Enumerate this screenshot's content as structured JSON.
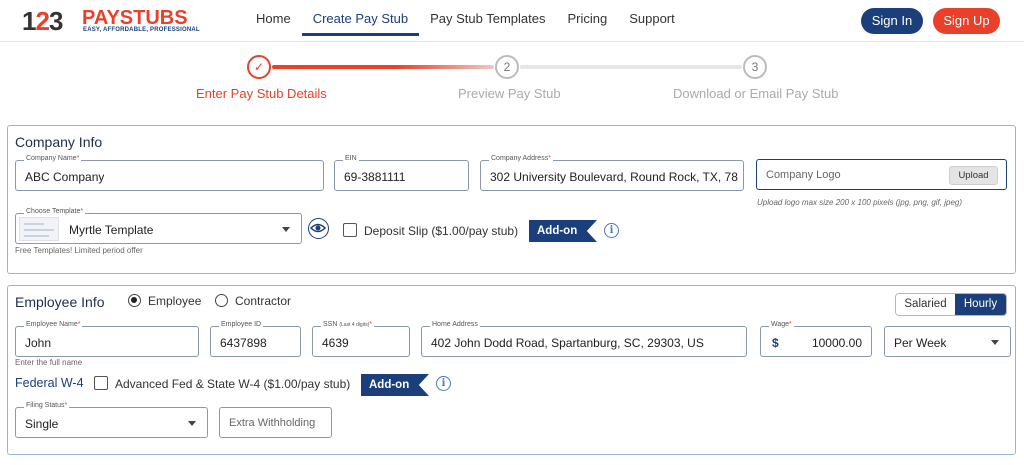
{
  "header": {
    "logo": {
      "number": "123",
      "brand": "PAYSTUBS",
      "tagline": "EASY, AFFORDABLE, PROFESSIONAL"
    },
    "nav": [
      "Home",
      "Create Pay Stub",
      "Pay Stub Templates",
      "Pricing",
      "Support"
    ],
    "active_nav": "Create Pay Stub",
    "sign_in": "Sign In",
    "sign_up": "Sign Up"
  },
  "stepper": {
    "steps": [
      {
        "number": "✓",
        "label": "Enter Pay Stub Details",
        "state": "active"
      },
      {
        "number": "2",
        "label": "Preview Pay Stub",
        "state": "inactive"
      },
      {
        "number": "3",
        "label": "Download or Email Pay Stub",
        "state": "inactive"
      }
    ]
  },
  "company": {
    "title": "Company Info",
    "name_label": "Company Name",
    "name_value": "ABC Company",
    "ein_label": "EIN",
    "ein_value": "69-3881111",
    "address_label": "Company Address",
    "address_value": "302 University Boulevard, Round Rock, TX, 78",
    "logo_placeholder": "Company Logo",
    "upload_label": "Upload",
    "logo_hint": "Upload logo max size 200 x 100 pixels (jpg, png, gif, jpeg)",
    "template_label": "Choose Template",
    "template_value": "Myrtle Template",
    "template_hint": "Free Templates! Limited period offer",
    "deposit_label": "Deposit Slip ($1.00/pay stub)",
    "addon_label": "Add-on",
    "info_glyph": "i"
  },
  "employee": {
    "title": "Employee Info",
    "radio_employee": "Employee",
    "radio_contractor": "Contractor",
    "selected_type": "Employee",
    "pay_toggle": [
      "Salaried",
      "Hourly"
    ],
    "pay_selected": "Hourly",
    "name_label": "Employee Name",
    "name_value": "John",
    "name_hint": "Enter the full name",
    "id_label": "Employee ID",
    "id_value": "6437898",
    "ssn_label": "SSN",
    "ssn_sub": "(Last 4 digits)",
    "ssn_value": "4639",
    "address_label": "Home Address",
    "address_value": "402 John Dodd Road, Spartanburg, SC, 29303, US",
    "wage_label": "Wage",
    "wage_currency": "$",
    "wage_value": "10000.00",
    "period_value": "Per Week",
    "federal_title": "Federal W-4",
    "advanced_label": "Advanced Fed & State W-4 ($1.00/pay stub)",
    "addon_label": "Add-on",
    "info_glyph": "i",
    "filing_label": "Filing Status",
    "filing_value": "Single",
    "extra_placeholder": "Extra Withholding"
  },
  "colors": {
    "brand_blue": "#1b3f7a",
    "accent_red": "#e8402a",
    "card_border": "#9db3d3"
  }
}
